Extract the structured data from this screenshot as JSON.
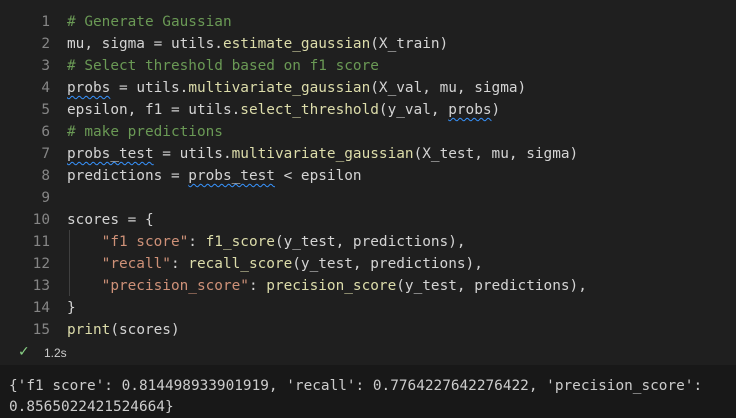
{
  "colors": {
    "background": "#1f1f1f",
    "output_background": "#181818",
    "comment": "#6a9955",
    "string": "#ce9178",
    "function": "#dcdcaa",
    "line_number": "#858585",
    "success": "#89d185",
    "squiggle": "#3794ff"
  },
  "lines": [
    {
      "n": "1",
      "tokens": [
        [
          "# Generate Gaussian",
          "c-comment"
        ]
      ]
    },
    {
      "n": "2",
      "tokens": [
        [
          "mu, sigma = utils.",
          "c-plain"
        ],
        [
          "estimate_gaussian",
          "c-fn"
        ],
        [
          "(X_train)",
          "c-plain"
        ]
      ]
    },
    {
      "n": "3",
      "tokens": [
        [
          "# Select threshold based on f1 score",
          "c-comment"
        ]
      ]
    },
    {
      "n": "4",
      "tokens": [
        [
          "probs",
          "c-plain squiggle"
        ],
        [
          " = utils.",
          "c-plain"
        ],
        [
          "multivariate_gaussian",
          "c-fn"
        ],
        [
          "(X_val, mu, sigma)",
          "c-plain"
        ]
      ]
    },
    {
      "n": "5",
      "tokens": [
        [
          "epsilon, f1 = utils.",
          "c-plain"
        ],
        [
          "select_threshold",
          "c-fn"
        ],
        [
          "(y_val, ",
          "c-plain"
        ],
        [
          "probs",
          "c-plain squiggle"
        ],
        [
          ")",
          "c-plain"
        ]
      ]
    },
    {
      "n": "6",
      "tokens": [
        [
          "# make predictions",
          "c-comment"
        ]
      ]
    },
    {
      "n": "7",
      "tokens": [
        [
          "probs_test",
          "c-plain squiggle"
        ],
        [
          " = utils.",
          "c-plain"
        ],
        [
          "multivariate_gaussian",
          "c-fn"
        ],
        [
          "(X_test, mu, sigma)",
          "c-plain"
        ]
      ]
    },
    {
      "n": "8",
      "tokens": [
        [
          "predictions = ",
          "c-plain"
        ],
        [
          "probs_test",
          "c-plain squiggle"
        ],
        [
          " < epsilon",
          "c-plain"
        ]
      ]
    },
    {
      "n": "9",
      "tokens": []
    },
    {
      "n": "10",
      "tokens": [
        [
          "scores = {",
          "c-plain"
        ]
      ]
    },
    {
      "n": "11",
      "tokens": [
        [
          "    ",
          "c-plain"
        ],
        [
          "\"f1 score\"",
          "c-str"
        ],
        [
          ": ",
          "c-plain"
        ],
        [
          "f1_score",
          "c-fn"
        ],
        [
          "(y_test, predictions),",
          "c-plain"
        ]
      ]
    },
    {
      "n": "12",
      "tokens": [
        [
          "    ",
          "c-plain"
        ],
        [
          "\"recall\"",
          "c-str"
        ],
        [
          ": ",
          "c-plain"
        ],
        [
          "recall_score",
          "c-fn"
        ],
        [
          "(y_test, predictions),",
          "c-plain"
        ]
      ]
    },
    {
      "n": "13",
      "tokens": [
        [
          "    ",
          "c-plain"
        ],
        [
          "\"precision_score\"",
          "c-str"
        ],
        [
          ": ",
          "c-plain"
        ],
        [
          "precision_score",
          "c-fn"
        ],
        [
          "(y_test, predictions),",
          "c-plain"
        ]
      ]
    },
    {
      "n": "14",
      "tokens": [
        [
          "}",
          "c-plain"
        ]
      ]
    },
    {
      "n": "15",
      "tokens": [
        [
          "print",
          "c-fn"
        ],
        [
          "(scores)",
          "c-plain"
        ]
      ]
    }
  ],
  "status": {
    "icon": "check-icon",
    "check_glyph": "✓",
    "duration": "1.2s"
  },
  "output": {
    "text": "{'f1 score': 0.814498933901919, 'recall': 0.7764227642276422, 'precision_score': 0.8565022421524664}"
  }
}
